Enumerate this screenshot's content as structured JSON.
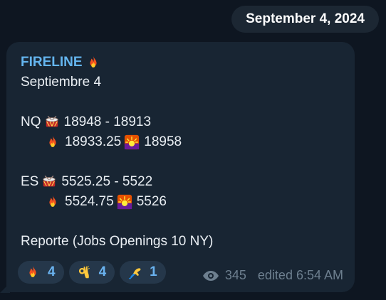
{
  "date_pill": "September 4, 2024",
  "message": {
    "sender": "FIRELINE",
    "sender_emoji": "fire-icon",
    "lines": {
      "subtitle": "Septiembre 4",
      "nq_label": "NQ",
      "nq_range": "18948 - 18913",
      "nq_fire_value": "18933.25",
      "nq_sunrise_value": "18958",
      "es_label": "ES",
      "es_range": "5525.25 - 5522",
      "es_fire_value": "5524.75",
      "es_sunrise_value": "5526",
      "report": "Reporte (Jobs Openings 10 NY)"
    },
    "reactions": [
      {
        "icon": "fire-icon",
        "count": "4"
      },
      {
        "icon": "ok-hand-icon",
        "count": "4"
      },
      {
        "icon": "writing-hand-icon",
        "count": "1"
      }
    ],
    "views": "345",
    "edited": "edited 6:54 AM"
  },
  "colors": {
    "background": "#0e1621",
    "bubble": "#182533",
    "sender": "#64b5ef",
    "reaction_bg": "#25374a",
    "reaction_text": "#6ab3f0",
    "meta": "#6d7f8f"
  }
}
